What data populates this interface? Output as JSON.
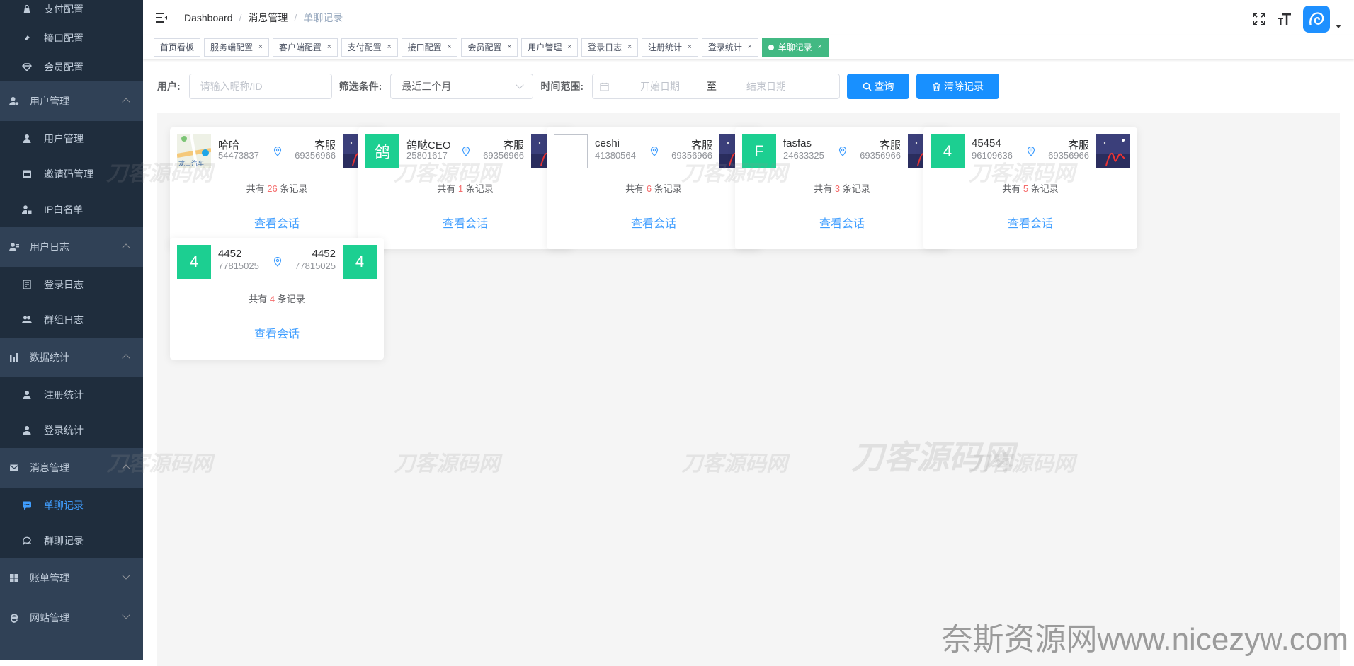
{
  "colors": {
    "sidebar": "#304156",
    "submenu": "#1f2d3d",
    "accent": "#409eff",
    "button": "#1890ff",
    "active_tag": "#42b983",
    "count_num": "#f56c6c",
    "avatar_green": "#1ccf91"
  },
  "sidebar": {
    "top_items": [
      {
        "label": "支付配置",
        "icon": "bag-icon"
      },
      {
        "label": "接口配置",
        "icon": "plug-icon"
      },
      {
        "label": "会员配置",
        "icon": "diamond-icon"
      }
    ],
    "groups": [
      {
        "label": "用户管理",
        "icon": "user-gear-icon",
        "expanded": true,
        "items": [
          {
            "label": "用户管理",
            "icon": "user-icon"
          },
          {
            "label": "邀请码管理",
            "icon": "card-icon"
          },
          {
            "label": "IP白名单",
            "icon": "user-lock-icon"
          }
        ]
      },
      {
        "label": "用户日志",
        "icon": "user-log-icon",
        "expanded": true,
        "items": [
          {
            "label": "登录日志",
            "icon": "doc-icon"
          },
          {
            "label": "群组日志",
            "icon": "users-icon"
          }
        ]
      },
      {
        "label": "数据统计",
        "icon": "bar-chart-icon",
        "expanded": true,
        "items": [
          {
            "label": "注册统计",
            "icon": "user-icon"
          },
          {
            "label": "登录统计",
            "icon": "user-icon"
          }
        ]
      },
      {
        "label": "消息管理",
        "icon": "mail-icon",
        "expanded": true,
        "items": [
          {
            "label": "单聊记录",
            "icon": "chat-icon",
            "active": true
          },
          {
            "label": "群聊记录",
            "icon": "chat-group-icon"
          }
        ]
      },
      {
        "label": "账单管理",
        "icon": "grid-icon",
        "expanded": false,
        "items": []
      },
      {
        "label": "网站管理",
        "icon": "ie-icon",
        "expanded": false,
        "items": []
      }
    ]
  },
  "breadcrumb": [
    "Dashboard",
    "消息管理",
    "单聊记录"
  ],
  "tags": [
    {
      "label": "首页看板",
      "closable": false
    },
    {
      "label": "服务端配置",
      "closable": true
    },
    {
      "label": "客户端配置",
      "closable": true
    },
    {
      "label": "支付配置",
      "closable": true
    },
    {
      "label": "接口配置",
      "closable": true
    },
    {
      "label": "会员配置",
      "closable": true
    },
    {
      "label": "用户管理",
      "closable": true
    },
    {
      "label": "登录日志",
      "closable": true
    },
    {
      "label": "注册统计",
      "closable": true
    },
    {
      "label": "登录统计",
      "closable": true
    },
    {
      "label": "单聊记录",
      "closable": true,
      "active": true
    }
  ],
  "tag_close": "×",
  "filter": {
    "user_label": "用户:",
    "user_placeholder": "请输入昵称/ID",
    "cond_label": "筛选条件:",
    "cond_value": "最近三个月",
    "range_label": "时间范围:",
    "start_placeholder": "开始日期",
    "range_sep": "至",
    "end_placeholder": "结束日期",
    "query_button": "查询",
    "clear_button": "清除记录"
  },
  "cards": [
    {
      "left_name": "哈哈",
      "left_id": "54473837",
      "left_avatar": "map",
      "right_name": "客服",
      "right_id": "69356966",
      "right_avatar": "photo",
      "count": "26"
    },
    {
      "left_name": "鸽哒CEO",
      "left_id": "25801617",
      "left_avatar": "green",
      "left_letter": "鸽",
      "right_name": "客服",
      "right_id": "69356966",
      "right_avatar": "photo",
      "count": "1"
    },
    {
      "left_name": "ceshi",
      "left_id": "41380564",
      "left_avatar": "broken",
      "right_name": "客服",
      "right_id": "69356966",
      "right_avatar": "photo",
      "count": "6"
    },
    {
      "left_name": "fasfas",
      "left_id": "24633325",
      "left_avatar": "green",
      "left_letter": "F",
      "right_name": "客服",
      "right_id": "69356966",
      "right_avatar": "photo",
      "count": "3"
    },
    {
      "left_name": "45454",
      "left_id": "96109636",
      "left_avatar": "green",
      "left_letter": "4",
      "right_name": "客服",
      "right_id": "69356966",
      "right_avatar": "photo",
      "count": "5"
    },
    {
      "left_name": "4452",
      "left_id": "77815025",
      "left_avatar": "green",
      "left_letter": "4",
      "right_name": "4452",
      "right_id": "77815025",
      "right_avatar": "green",
      "right_letter": "4",
      "count": "4"
    }
  ],
  "card_text": {
    "prefix": "共有",
    "suffix": "条记录",
    "view": "查看会话"
  },
  "map_text": "龙山汽车",
  "watermarks": [
    "刀客源码网",
    "刀客源码网",
    "刀客源码网",
    "刀客源码网",
    "刀客源码网",
    "刀客源码网",
    "刀客源码网",
    "刀客源码网",
    "刀客源码网",
    "刀客源码网"
  ],
  "footer_watermark": "奈斯资源网www.nicezyw.com"
}
